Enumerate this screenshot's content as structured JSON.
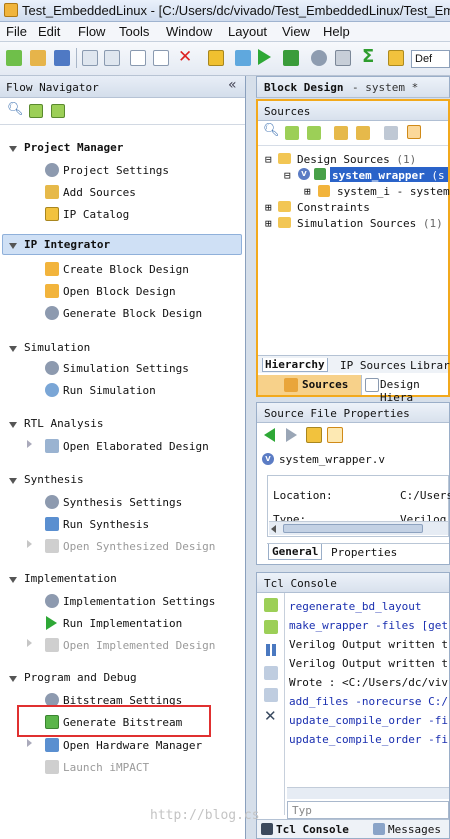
{
  "window": {
    "title": "Test_EmbeddedLinux - [C:/Users/dc/vivado/Test_EmbeddedLinux/Test_Em"
  },
  "menu": [
    "File",
    "Edit",
    "Flow",
    "Tools",
    "Window",
    "Layout",
    "View",
    "Help"
  ],
  "toolbar": {
    "layout_select_value": "Def"
  },
  "flow_navigator": {
    "title": "Flow Navigator",
    "collapse_label": "«",
    "sections": {
      "project_manager": {
        "title": "Project Manager",
        "items": [
          "Project Settings",
          "Add Sources",
          "IP Catalog"
        ]
      },
      "ip_integrator": {
        "title": "IP Integrator",
        "items": [
          "Create Block Design",
          "Open Block Design",
          "Generate Block Design"
        ]
      },
      "simulation": {
        "title": "Simulation",
        "items": [
          "Simulation Settings",
          "Run Simulation"
        ]
      },
      "rtl_analysis": {
        "title": "RTL Analysis",
        "items": [
          "Open Elaborated Design"
        ]
      },
      "synthesis": {
        "title": "Synthesis",
        "items": [
          "Synthesis Settings",
          "Run Synthesis",
          "Open Synthesized Design"
        ]
      },
      "implementation": {
        "title": "Implementation",
        "items": [
          "Implementation Settings",
          "Run Implementation",
          "Open Implemented Design"
        ]
      },
      "program_debug": {
        "title": "Program and Debug",
        "items": [
          "Bitstream Settings",
          "Generate Bitstream",
          "Open Hardware Manager",
          "Launch iMPACT"
        ]
      }
    }
  },
  "block_design": {
    "title": "Block Design",
    "subtitle": "- system *"
  },
  "sources": {
    "title": "Sources",
    "tree": {
      "design_sources": "Design Sources",
      "design_sources_count": "(1)",
      "wrapper": "system_wrapper",
      "wrapper_suffix": "(s",
      "system_i": "system_i - system",
      "constraints": "Constraints",
      "simulation_sources": "Simulation Sources",
      "simulation_sources_count": "(1)"
    },
    "inner_tabs": [
      "Hierarchy",
      "IP Sources",
      "Librar"
    ],
    "outer_tabs": [
      "Sources",
      "Design Hiera"
    ]
  },
  "source_file_properties": {
    "title": "Source File Properties",
    "file": "system_wrapper.v",
    "location_label": "Location:",
    "location_value": "C:/Users/",
    "type_label": "Type:",
    "type_value": "Verilog",
    "tabs": [
      "General",
      "Properties"
    ]
  },
  "tcl_console": {
    "title": "Tcl Console",
    "lines": [
      {
        "text": "regenerate_bd_layout",
        "kind": "cmd"
      },
      {
        "text": "make_wrapper -files [get",
        "kind": "cmd"
      },
      {
        "text": "Verilog Output written t",
        "kind": "out"
      },
      {
        "text": "Verilog Output written t",
        "kind": "out"
      },
      {
        "text": "Wrote  : <C:/Users/dc/viv",
        "kind": "out"
      },
      {
        "text": "add_files -norecurse C:/",
        "kind": "cmd"
      },
      {
        "text": "update_compile_order -fi",
        "kind": "cmd"
      },
      {
        "text": "update_compile_order -fi",
        "kind": "cmd"
      }
    ],
    "input_placeholder": "Typ",
    "bottom_tabs": [
      "Tcl Console",
      "Messages"
    ]
  },
  "watermark": "http://blog.cs",
  "colors": {
    "highlight_box": "#e03030",
    "selected_item": "#2a63c9",
    "orange_accent": "#f2a91c",
    "cmd_text": "#1a2fb0"
  }
}
